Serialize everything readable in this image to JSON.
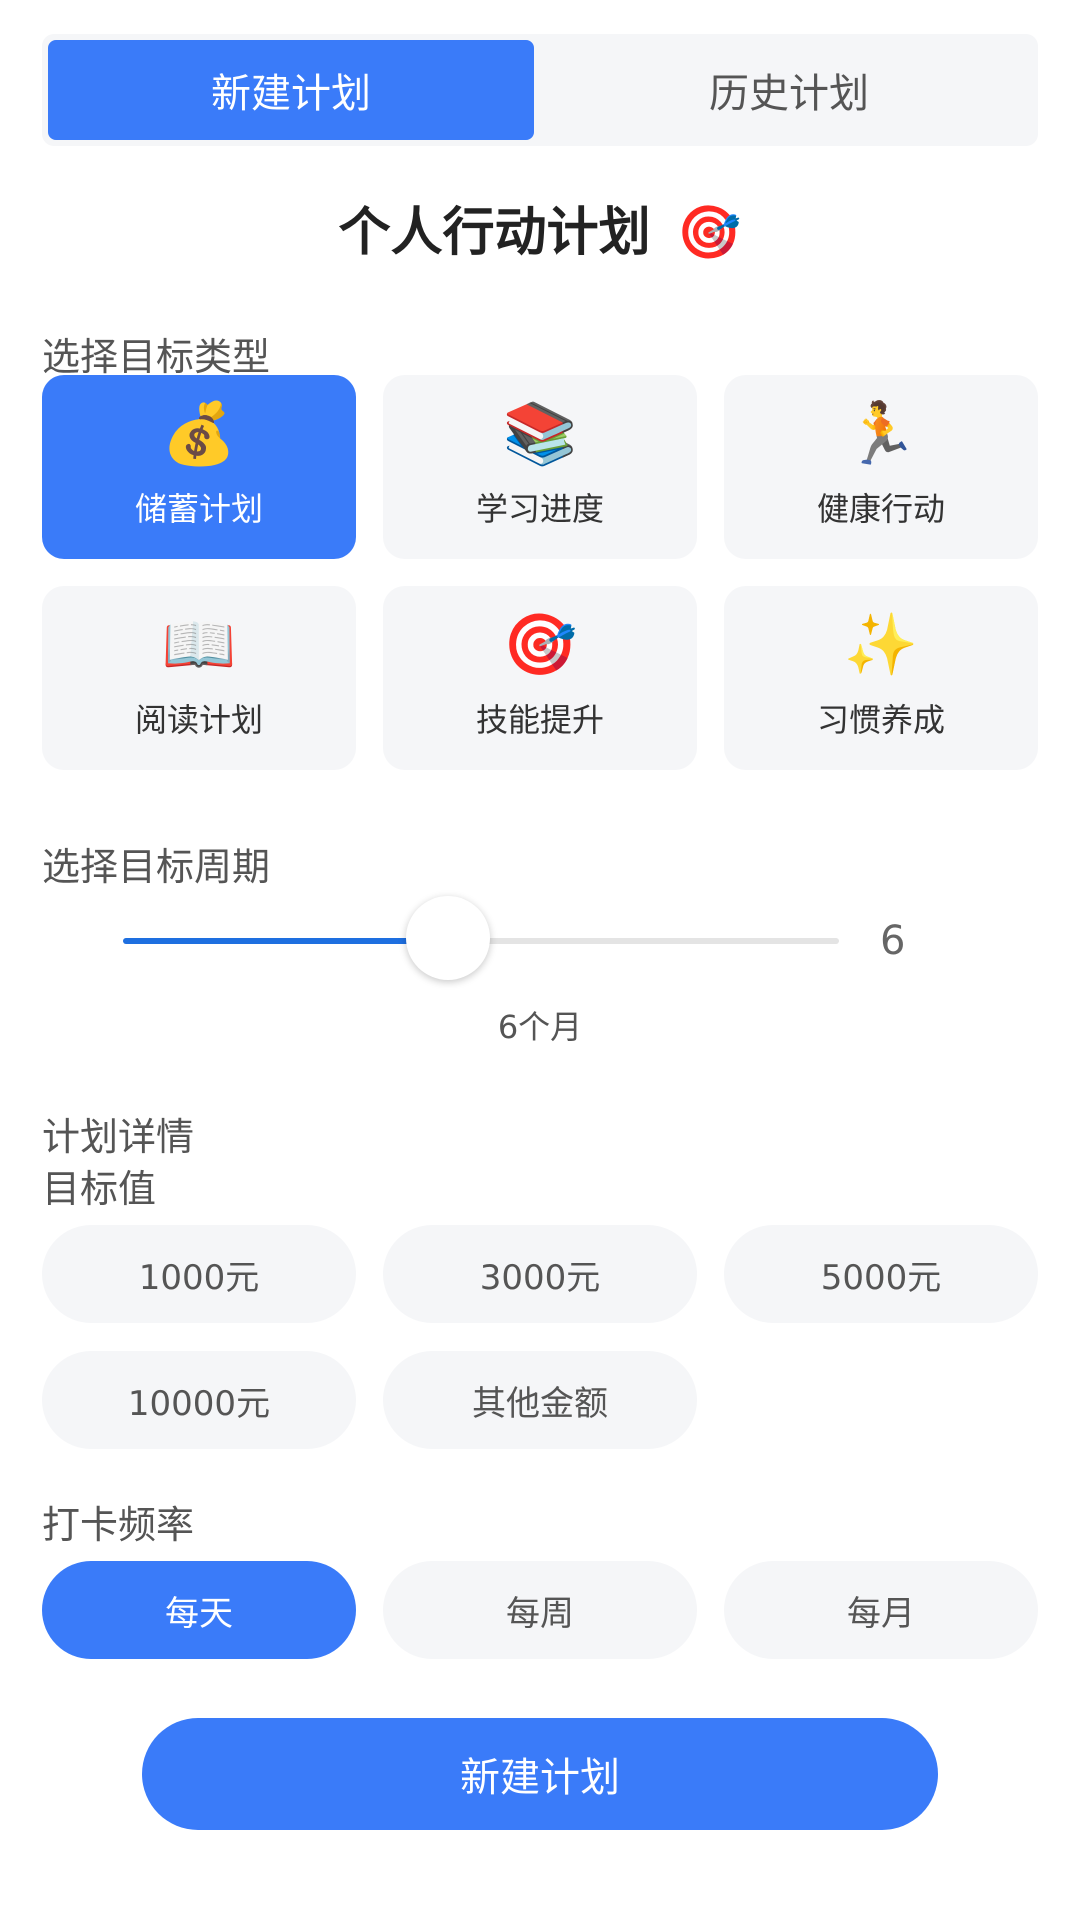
{
  "tabs": [
    {
      "label": "新建计划",
      "active": true
    },
    {
      "label": "历史计划",
      "active": false
    }
  ],
  "title": {
    "text": "个人行动计划",
    "emoji": "🎯"
  },
  "goal_type": {
    "label": "选择目标类型",
    "options": [
      {
        "icon": "💰",
        "icon_name": "money-bag-icon",
        "label": "储蓄计划",
        "selected": true
      },
      {
        "icon": "📚",
        "icon_name": "books-icon",
        "label": "学习进度",
        "selected": false
      },
      {
        "icon": "🏃",
        "icon_name": "runner-icon",
        "label": "健康行动",
        "selected": false
      },
      {
        "icon": "📖",
        "icon_name": "open-book-icon",
        "label": "阅读计划",
        "selected": false
      },
      {
        "icon": "🎯",
        "icon_name": "target-icon",
        "label": "技能提升",
        "selected": false
      },
      {
        "icon": "✨",
        "icon_name": "sparkles-icon",
        "label": "习惯养成",
        "selected": false
      }
    ]
  },
  "period": {
    "label": "选择目标周期",
    "value": "6",
    "min": 1,
    "max": 12,
    "caption": "6个月"
  },
  "details": {
    "label": "计划详情",
    "target_label": "目标值",
    "targets": [
      "1000元",
      "3000元",
      "5000元",
      "10000元",
      "其他金额"
    ]
  },
  "frequency": {
    "label": "打卡频率",
    "options": [
      {
        "label": "每天",
        "selected": true
      },
      {
        "label": "每周",
        "selected": false
      },
      {
        "label": "每月",
        "selected": false
      }
    ]
  },
  "submit": {
    "label": "新建计划"
  },
  "colors": {
    "accent": "#3a7bf9",
    "slider_fill": "#1e6fe0",
    "card_bg": "#f5f6f8"
  }
}
